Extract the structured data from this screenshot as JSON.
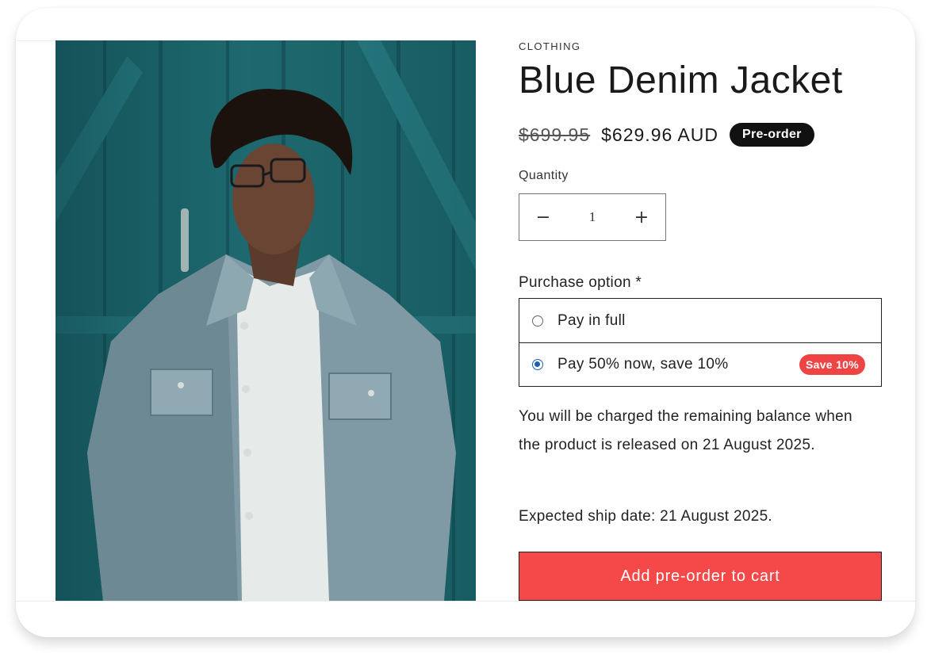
{
  "product": {
    "vendor": "CLOTHING",
    "title": "Blue Denim Jacket",
    "price_original": "$699.95",
    "price_sale": "$629.96 AUD",
    "badge": "Pre-order",
    "image_description": "product-photo-denim-jacket"
  },
  "quantity": {
    "label": "Quantity",
    "value": "1",
    "decrease_symbol": "−",
    "increase_symbol": "+"
  },
  "purchase_option": {
    "label": "Purchase option *",
    "options": [
      {
        "label": "Pay in full",
        "selected": false,
        "badge": ""
      },
      {
        "label": "Pay 50% now, save 10%",
        "selected": true,
        "badge": "Save 10%"
      }
    ]
  },
  "balance_note": "You will be charged the remaining balance when the product is released on 21 August 2025.",
  "ship_note": "Expected ship date: 21 August 2025.",
  "cart_button": "Add pre-order to cart",
  "colors": {
    "accent": "#f54848",
    "save_badge": "#ef4444",
    "badge_dark": "#111111",
    "radio_selected": "#1a5fb4"
  },
  "icons": {
    "decrease": "minus-icon",
    "increase": "plus-icon"
  }
}
